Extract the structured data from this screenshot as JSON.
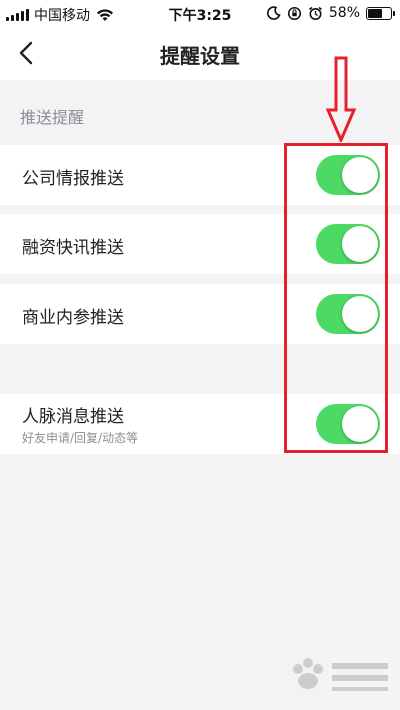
{
  "status_bar": {
    "carrier": "中国移动",
    "time": "下午3:25",
    "battery_percent": "58%",
    "battery_level": 0.58
  },
  "nav": {
    "title": "提醒设置"
  },
  "section": {
    "header": "推送提醒"
  },
  "rows": [
    {
      "label": "公司情报推送",
      "on": true
    },
    {
      "label": "融资快讯推送",
      "on": true
    },
    {
      "label": "商业内参推送",
      "on": true
    },
    {
      "label": "人脉消息推送",
      "sublabel": "好友申请/回复/动态等",
      "on": true
    }
  ],
  "colors": {
    "switch_on": "#4cd964",
    "annotation": "#e5202a",
    "background": "#f3f3f5"
  },
  "icons": [
    "signal-icon",
    "wifi-icon",
    "moon-icon",
    "lock-rotation-icon",
    "alarm-icon",
    "battery-icon",
    "back-chevron-icon",
    "down-arrow-annotation-icon"
  ]
}
